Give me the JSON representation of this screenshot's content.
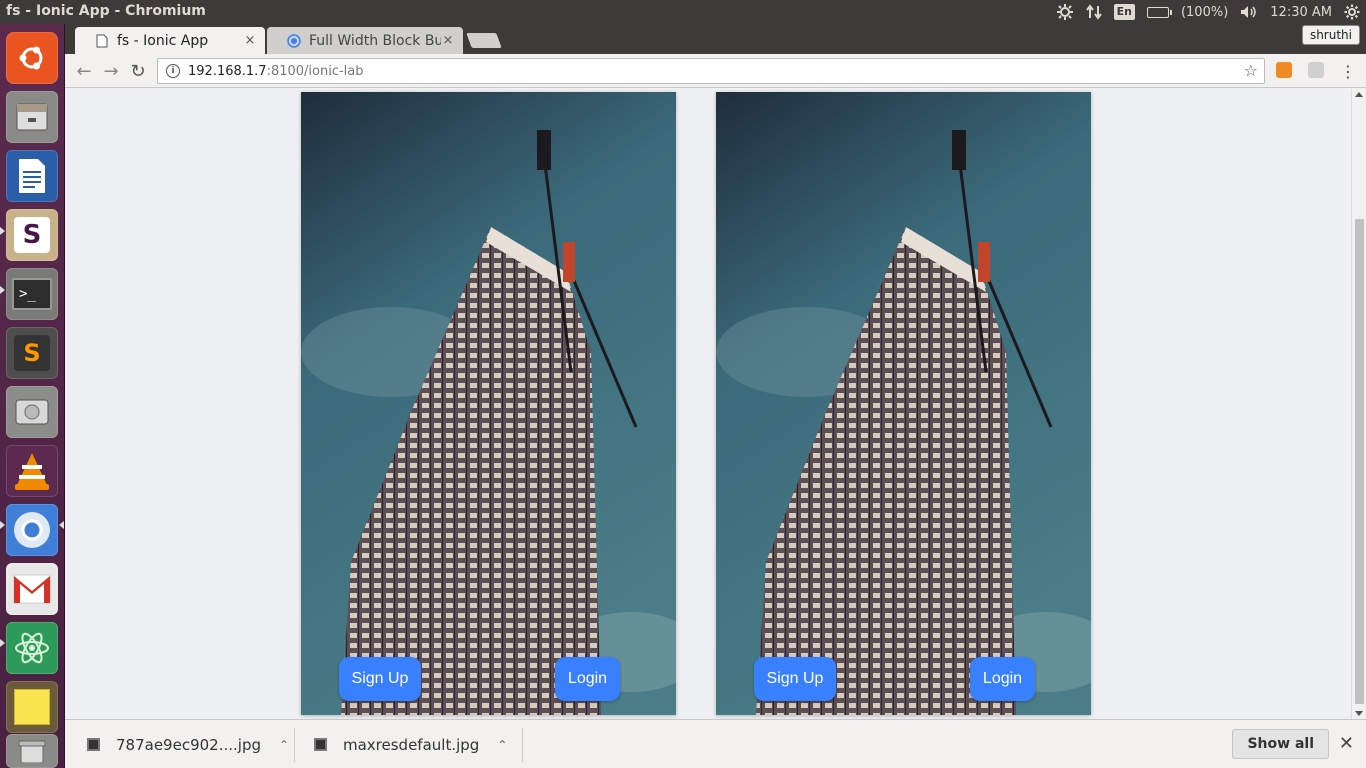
{
  "window": {
    "title": "fs - Ionic App - Chromium"
  },
  "panel": {
    "keyboard": "En",
    "battery": "(100%)",
    "time": "12:30 AM",
    "icons": [
      "network-settings-icon",
      "transfer-arrows-icon",
      "battery-icon",
      "volume-icon",
      "system-gear-icon"
    ]
  },
  "launcher": {
    "items": [
      "ubuntu-dash",
      "files",
      "libreoffice-writer",
      "slack",
      "terminal",
      "sublime-text",
      "disk",
      "vlc",
      "chromium",
      "gmail",
      "atom",
      "sticky-notes",
      "trash"
    ]
  },
  "tabs": [
    {
      "title": "fs - Ionic App",
      "close": "×"
    },
    {
      "title": "Full Width Block Bu",
      "close": "×"
    }
  ],
  "profile": "shruthi",
  "address": {
    "host": "192.168.1.7",
    "rest": ":8100/ionic-lab"
  },
  "devices": [
    {
      "signup": "Sign Up",
      "login": "Login"
    },
    {
      "signup": "Sign Up",
      "login": "Login"
    }
  ],
  "downloads": [
    {
      "name": "787ae9ec902....jpg"
    },
    {
      "name": "maxresdefault.jpg"
    }
  ],
  "shelf": {
    "show_all": "Show all"
  },
  "colors": {
    "ionic_primary": "#3880ff",
    "launcher": "#5b2a4e"
  }
}
